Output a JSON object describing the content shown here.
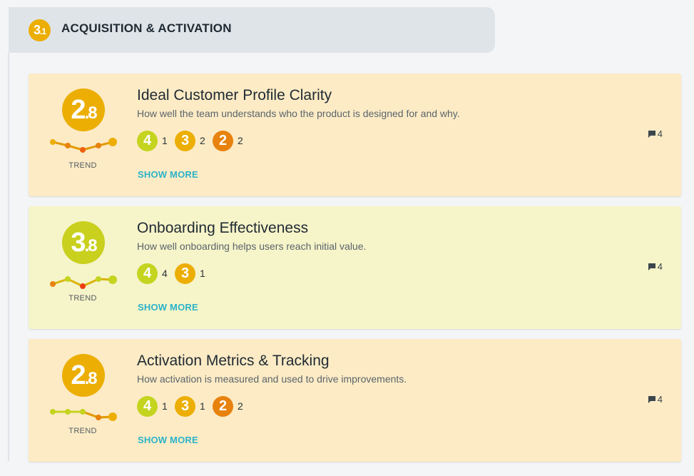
{
  "section": {
    "number_major": "3",
    "number_minor": ".1",
    "title": "ACQUISITION & ACTIVATION"
  },
  "colors": {
    "score4": "#c4d41f",
    "score3": "#ecae02",
    "score2": "#e8820e",
    "low": "#ef5f10",
    "card_orange": "#fcebc5",
    "card_yellow": "#f6f4c9",
    "link": "#2bb3c9"
  },
  "cards": [
    {
      "title": "Ideal Customer Profile Clarity",
      "description": "How well the team understands who the product is designed for and why.",
      "score_major": "2",
      "score_minor": ".8",
      "trend_label": "TREND",
      "votes": [
        {
          "level": "4",
          "count": "1"
        },
        {
          "level": "3",
          "count": "2"
        },
        {
          "level": "2",
          "count": "2"
        }
      ],
      "show_more": "SHOW MORE",
      "comments": "4"
    },
    {
      "title": "Onboarding Effectiveness",
      "description": "How well onboarding helps users reach initial value.",
      "score_major": "3",
      "score_minor": ".8",
      "trend_label": "TREND",
      "votes": [
        {
          "level": "4",
          "count": "4"
        },
        {
          "level": "3",
          "count": "1"
        }
      ],
      "show_more": "SHOW MORE",
      "comments": "4"
    },
    {
      "title": "Activation Metrics & Tracking",
      "description": "How activation is measured and used to drive improvements.",
      "score_major": "2",
      "score_minor": ".8",
      "trend_label": "TREND",
      "votes": [
        {
          "level": "4",
          "count": "1"
        },
        {
          "level": "3",
          "count": "1"
        },
        {
          "level": "2",
          "count": "2"
        }
      ],
      "show_more": "SHOW MORE",
      "comments": "4"
    }
  ]
}
